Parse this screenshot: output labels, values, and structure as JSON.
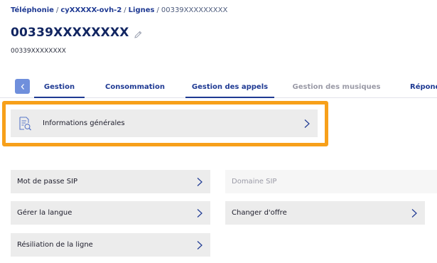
{
  "breadcrumb": {
    "items": [
      "Téléphonie",
      "cyXXXXX-ovh-2",
      "Lignes"
    ],
    "current": "00339XXXXXXXXX"
  },
  "header": {
    "title": "00339XXXXXXXX",
    "subtitle": "00339XXXXXXXX",
    "edit_icon": "pencil-icon"
  },
  "tabs": [
    {
      "label": "Gestion",
      "state": "active"
    },
    {
      "label": "Consommation",
      "state": "normal"
    },
    {
      "label": "Gestion des appels",
      "state": "underlined"
    },
    {
      "label": "Gestion des musiques",
      "state": "muted"
    },
    {
      "label": "Répondeur",
      "state": "normal"
    }
  ],
  "general_info": {
    "label": "Informations générales",
    "icon": "document-search-icon"
  },
  "actions": {
    "sip_password": "Mot de passe SIP",
    "sip_domain": "Domaine SIP",
    "language": "Gérer la langue",
    "change_offer": "Changer d'offre",
    "terminate": "Résiliation de la ligne"
  },
  "colors": {
    "highlight": "#f7a01a",
    "accent": "#1f3a93",
    "tab_prev_bg": "#6f8fdc",
    "card_bg": "#ececec"
  }
}
